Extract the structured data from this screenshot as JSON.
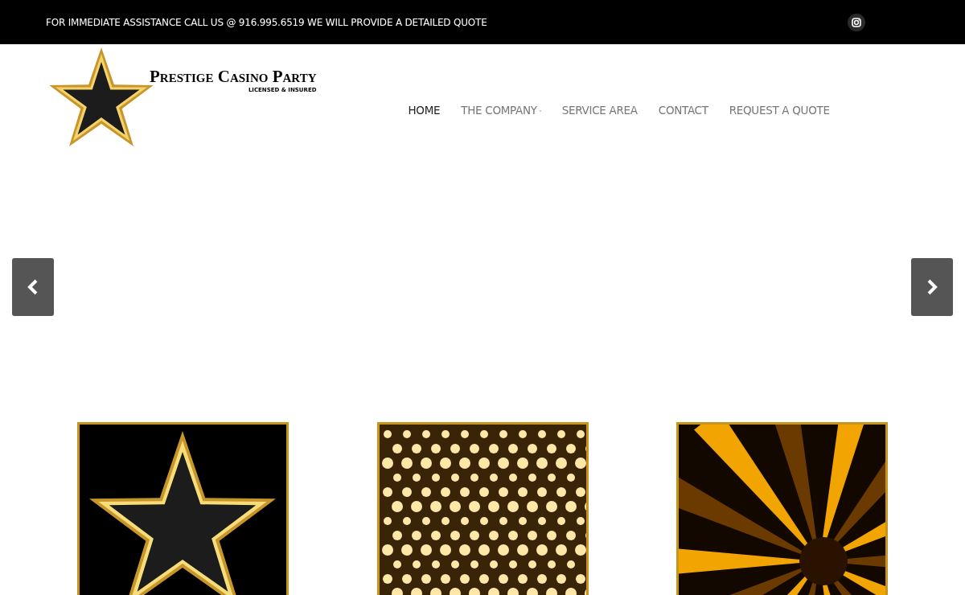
{
  "top_bar": {
    "text": "FOR IMMEDIATE ASSISTANCE CALL US @ 916.995.6519 WE WILL PROVIDE A DETAILED QUOTE"
  },
  "logo": {
    "name": "Prestige Casino Party",
    "tagline": "LICENSED & INSURED"
  },
  "nav": [
    {
      "label": "HOME",
      "selected": true,
      "has_submenu": false
    },
    {
      "label": "THE COMPANY",
      "selected": false,
      "has_submenu": true
    },
    {
      "label": "SERVICE AREA",
      "selected": false,
      "has_submenu": false
    },
    {
      "label": "CONTACT",
      "selected": false,
      "has_submenu": false
    },
    {
      "label": "REQUEST A QUOTE",
      "selected": false,
      "has_submenu": false
    }
  ],
  "tiles": [
    {
      "kind": "star"
    },
    {
      "kind": "lights"
    },
    {
      "kind": "rays"
    }
  ]
}
